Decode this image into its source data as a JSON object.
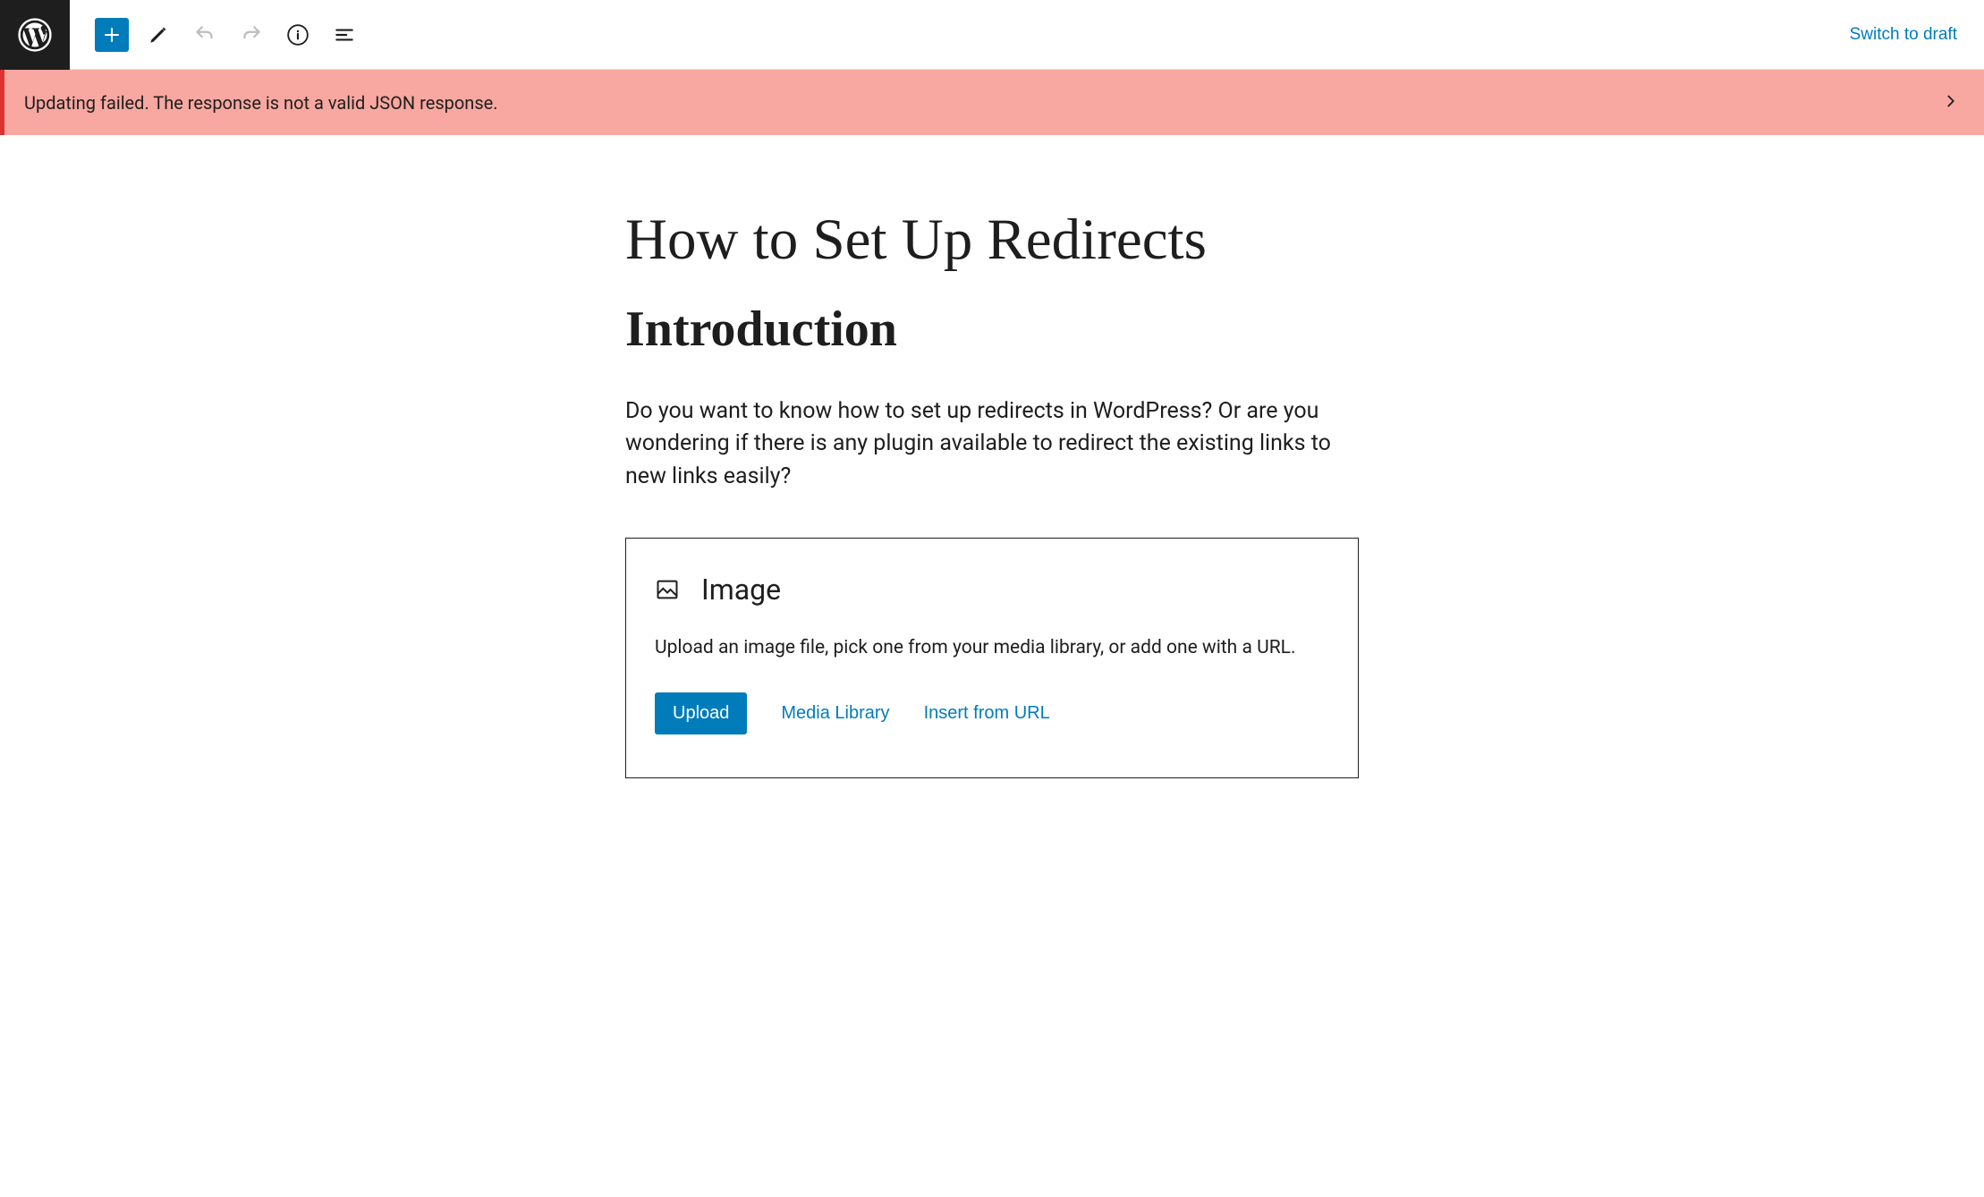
{
  "toolbar": {
    "switch_draft_label": "Switch to draft"
  },
  "error": {
    "message": "Updating failed. The response is not a valid JSON response."
  },
  "post": {
    "title": "How to Set Up Redirects",
    "heading": "Introduction",
    "paragraph": "Do you want to know how to set up redirects in WordPress?  Or are you wondering if there is any plugin available to redirect the existing links to new links easily?"
  },
  "image_block": {
    "title": "Image",
    "description": "Upload an image file, pick one from your media library, or add one with a URL.",
    "upload_label": "Upload",
    "media_library_label": "Media Library",
    "insert_url_label": "Insert from URL"
  }
}
